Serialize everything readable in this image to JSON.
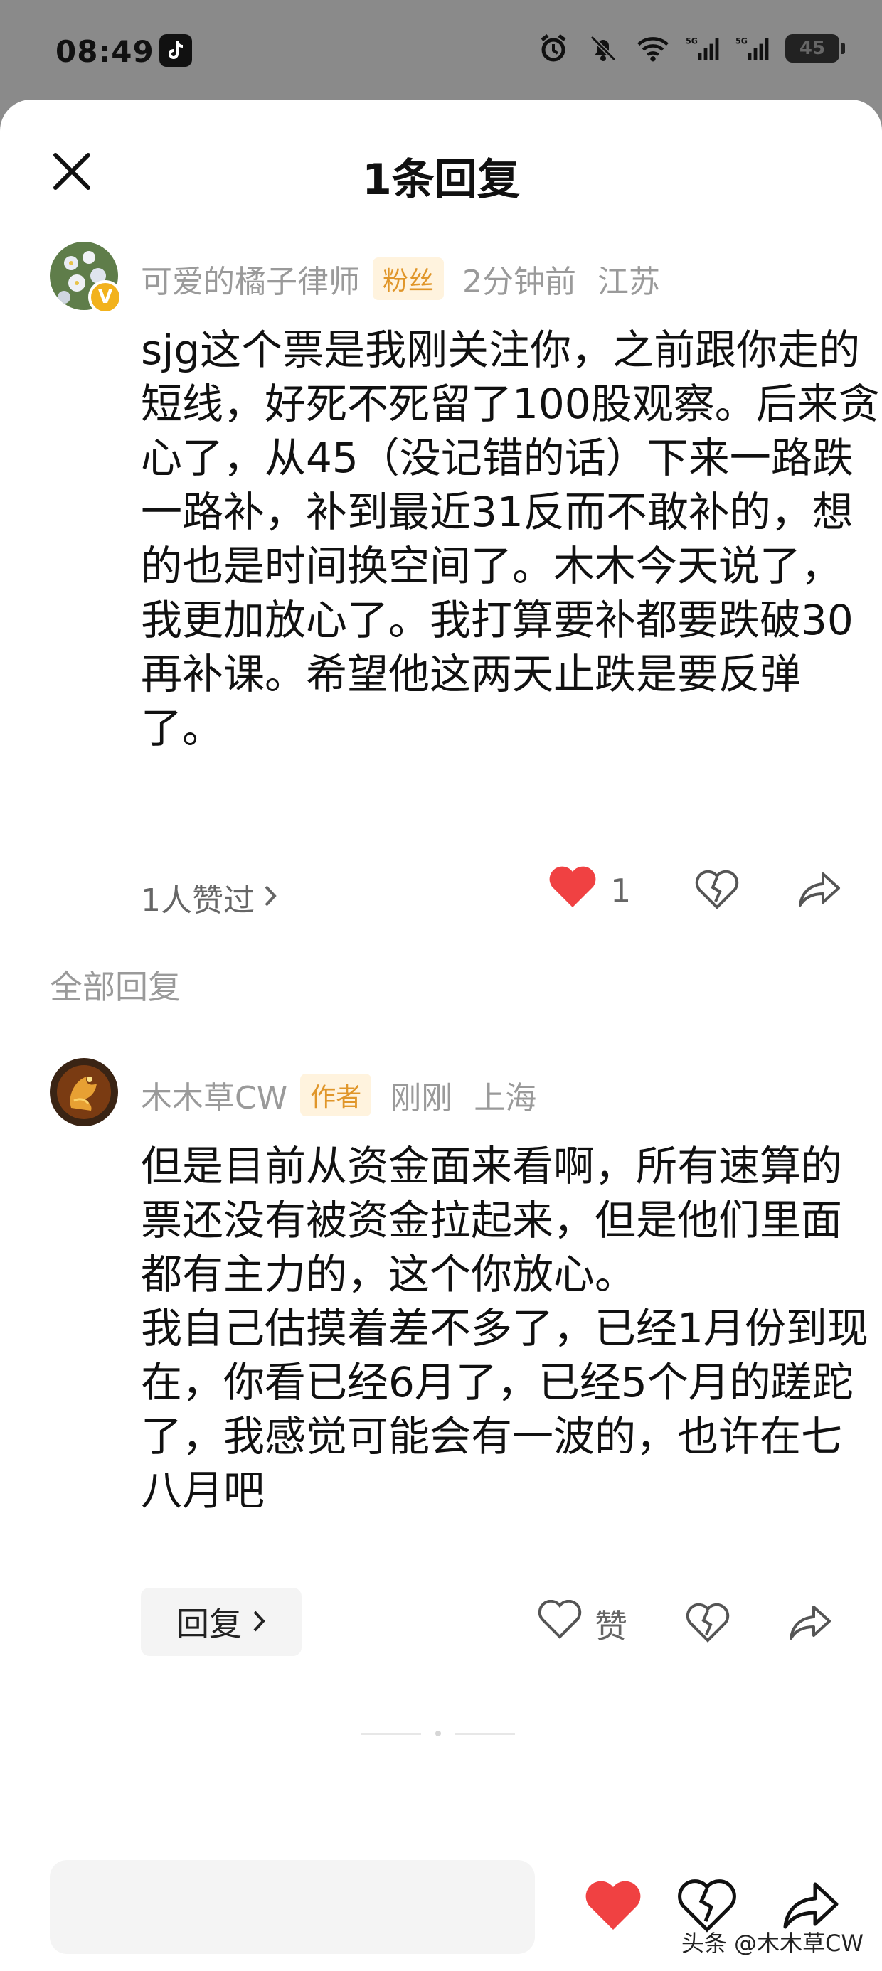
{
  "status_bar": {
    "time": "08:49",
    "icons": [
      "tiktok-icon",
      "alarm-icon",
      "bell-off-icon",
      "wifi-icon",
      "signal-5g-icon",
      "signal-5g-icon"
    ],
    "battery": "45"
  },
  "header": {
    "title": "1条回复"
  },
  "main_comment": {
    "username": "可爱的橘子律师",
    "tag": "粉丝",
    "time": "2分钟前",
    "location": "江苏",
    "text": "sjg这个票是我刚关注你，之前跟你走的短线，好死不死留了100股观察。后来贪心了，从45（没记错的话）下来一路跌一路补，补到最近31反而不敢补的，想的也是时间换空间了。木木今天说了，我更加放心了。我打算要补都要跌破30再补课。希望他这两天止跌是要反弹了。",
    "like_summary": "1人赞过",
    "like_count": "1",
    "liked": true
  },
  "section": {
    "label": "全部回复"
  },
  "reply": {
    "username": "木木草CW",
    "tag": "作者",
    "time": "刚刚",
    "location": "上海",
    "text": "但是目前从资金面来看啊，所有速算的票还没有被资金拉起来，但是他们里面都有主力的，这个你放心。\n我自己估摸着差不多了，已经1月份到现在，你看已经6月了，已经5个月的蹉跎了，我感觉可能会有一波的，也许在七八月吧",
    "reply_label": "回复",
    "like_label": "赞"
  },
  "watermark": "头条 @木木草CW",
  "colors": {
    "like_red": "#f04142",
    "tag_bg": "#fff3de",
    "tag_fg": "#e0962a",
    "meta_gray": "#9a9a9a"
  }
}
